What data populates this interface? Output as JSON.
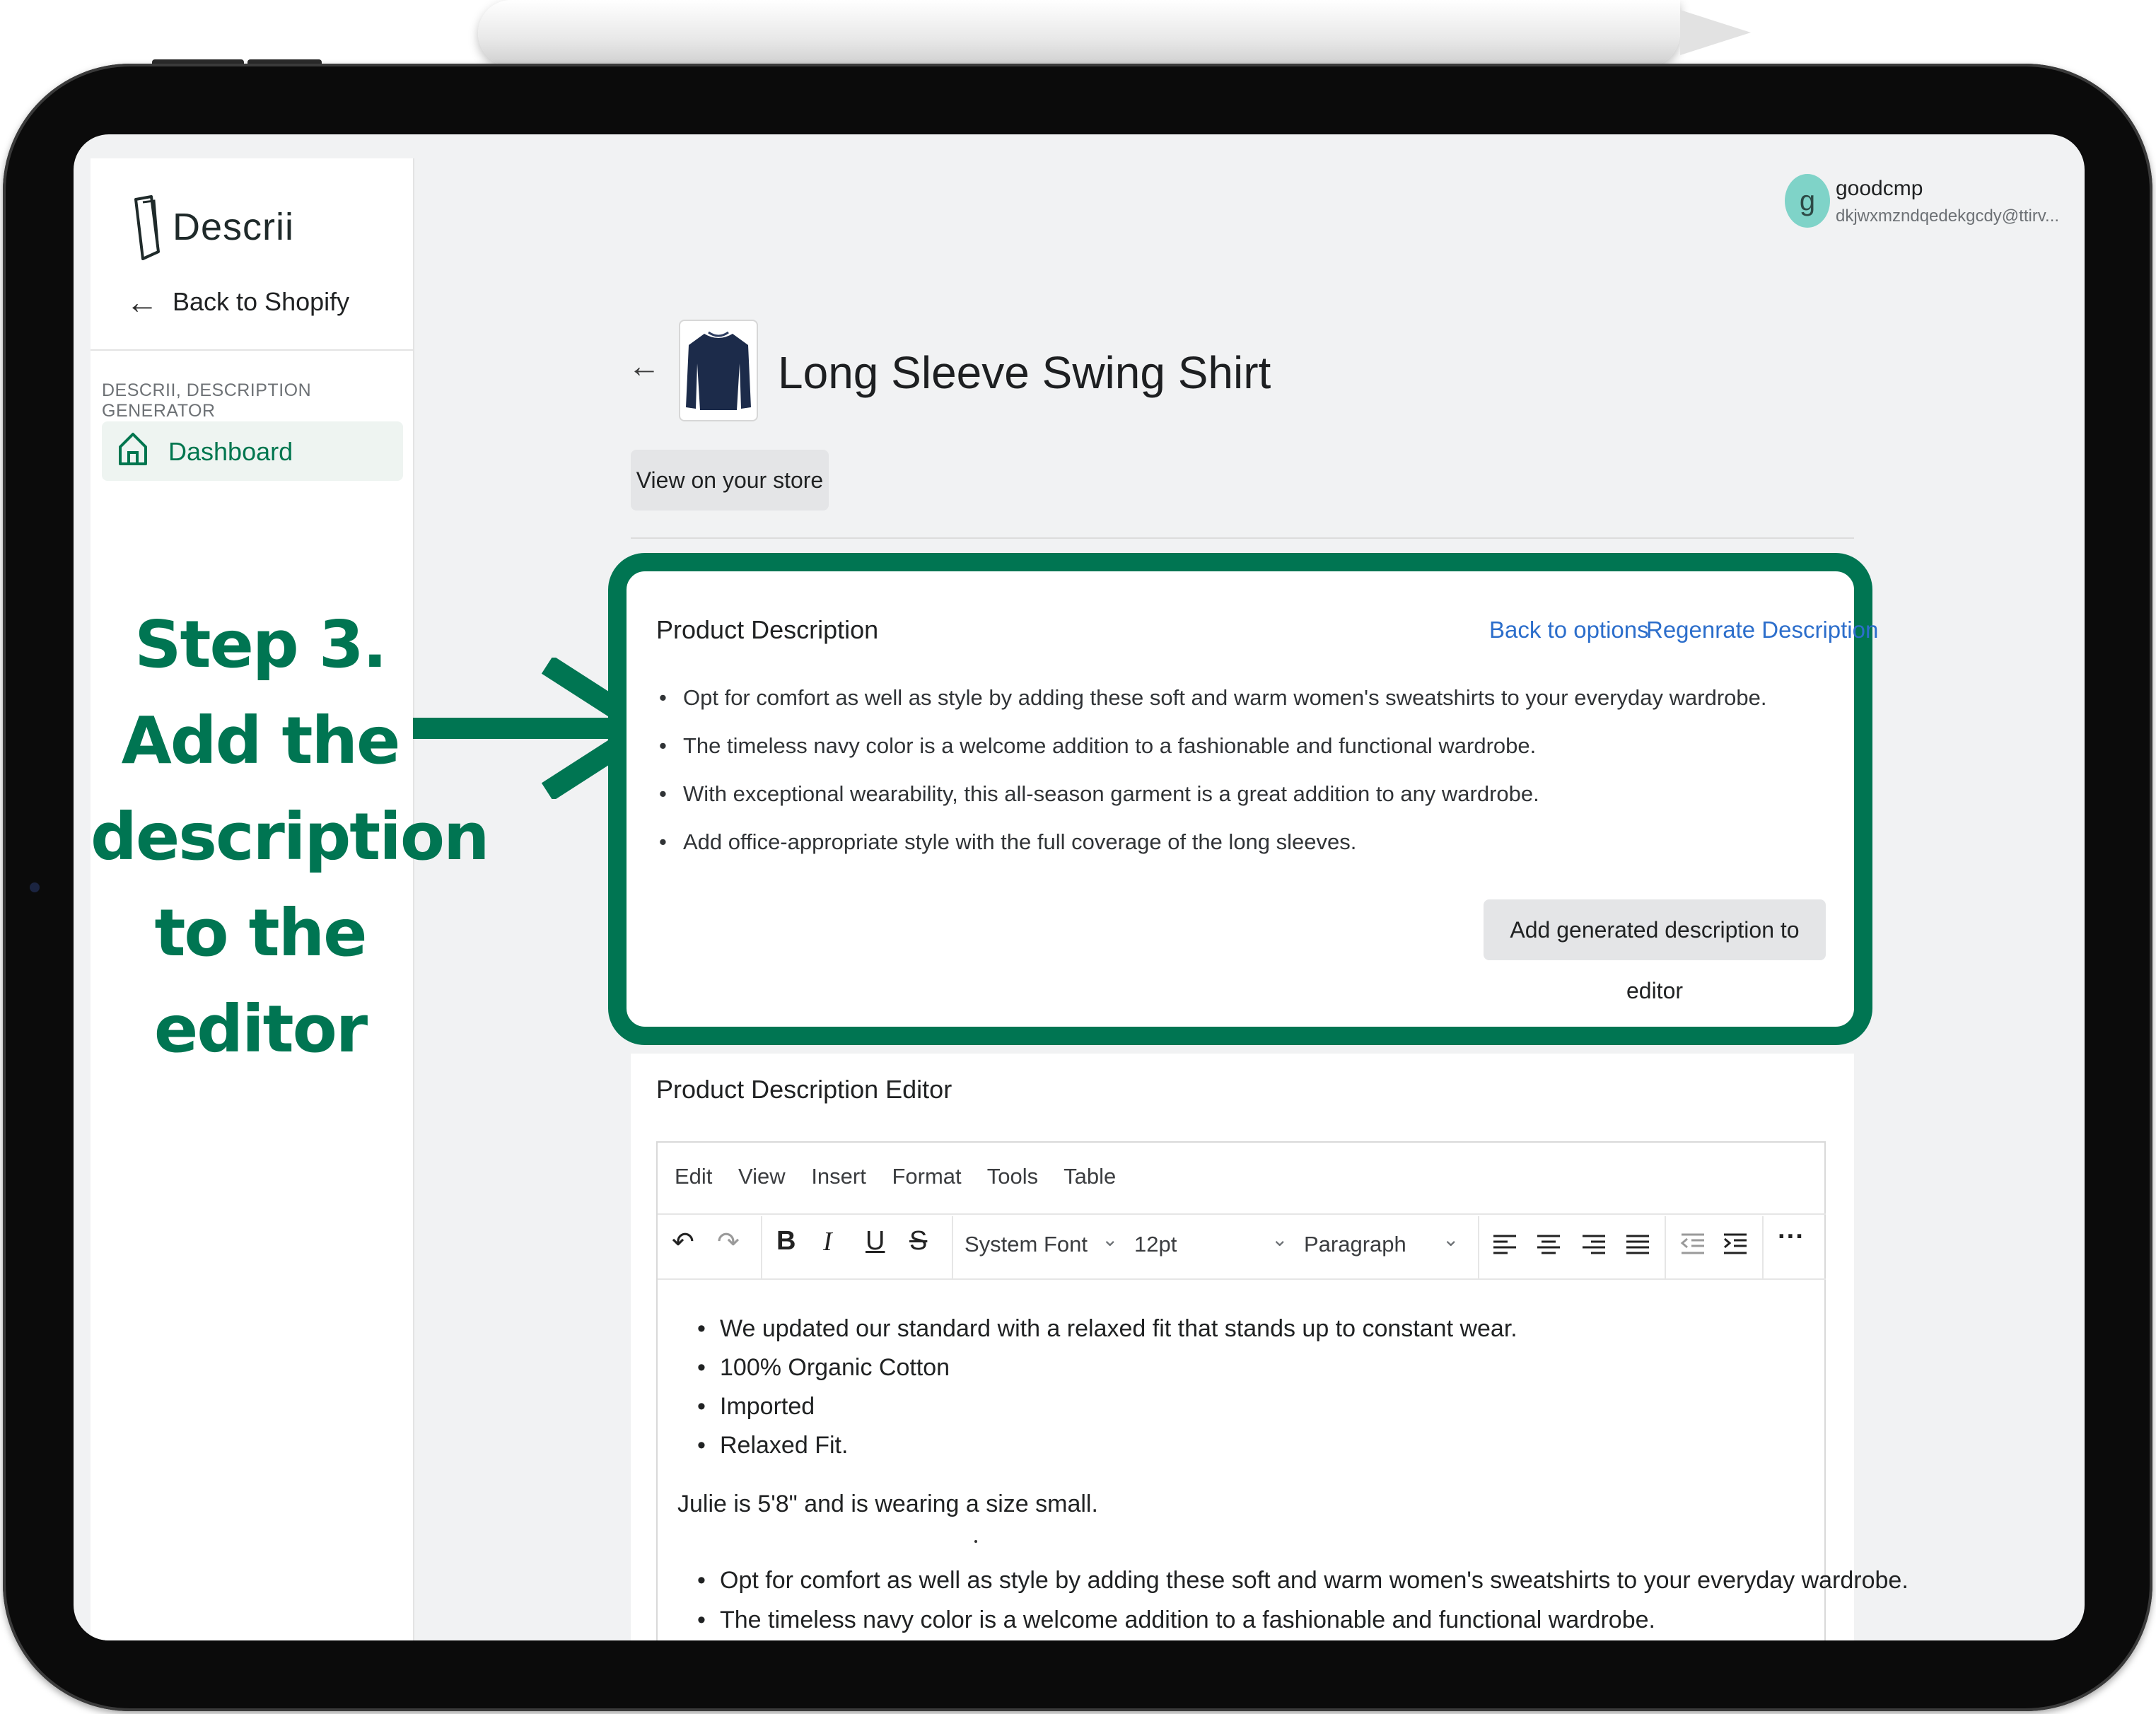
{
  "app": {
    "name": "Descrii",
    "back_link": "Back to Shopify",
    "section_label": "DESCRII, DESCRIPTION GENERATOR",
    "nav": [
      {
        "label": "Dashboard",
        "icon": "house-icon",
        "active": true
      }
    ]
  },
  "annotation": {
    "lines": [
      "Step 3.",
      "Add the",
      "description",
      "to the",
      "editor"
    ],
    "color": "#007552"
  },
  "user": {
    "initial": "g",
    "name": "goodcmp",
    "email": "dkjwxmzndqedekgcdy@ttirv..."
  },
  "product": {
    "title": "Long Sleeve Swing Shirt",
    "view_store_label": "View on your store"
  },
  "description_card": {
    "title": "Product Description",
    "back_to_options": "Back to options",
    "regenerate": "Regenrate Description",
    "bullets": [
      "Opt for comfort as well as style by adding these soft and warm women's sweatshirts to your everyday wardrobe.",
      "The timeless navy color is a welcome addition to a fashionable and functional wardrobe.",
      "With exceptional wearability, this all-season garment is a great addition to any wardrobe.",
      "Add office-appropriate style with the full coverage of the long sleeves."
    ],
    "add_button": "Add generated description to editor"
  },
  "editor": {
    "title": "Product Description Editor",
    "menu": [
      "Edit",
      "View",
      "Insert",
      "Format",
      "Tools",
      "Table"
    ],
    "font_family": "System Font",
    "font_size": "12pt",
    "block_format": "Paragraph",
    "content_bullets": [
      "We updated our standard with a relaxed fit that stands up to constant wear.",
      "100% Organic Cotton",
      "Imported",
      "Relaxed Fit."
    ],
    "content_paragraph": "Julie is 5'8\" and is wearing a size small.",
    "content_bullets_2": [
      "Opt for comfort as well as style by adding these soft and warm women's sweatshirts to your everyday wardrobe.",
      "The timeless navy color is a welcome addition to a fashionable and functional wardrobe."
    ]
  },
  "colors": {
    "accent": "#007552",
    "link": "#2c6ecb",
    "button_bg": "#e4e5e7",
    "page_bg": "#f1f2f3"
  }
}
